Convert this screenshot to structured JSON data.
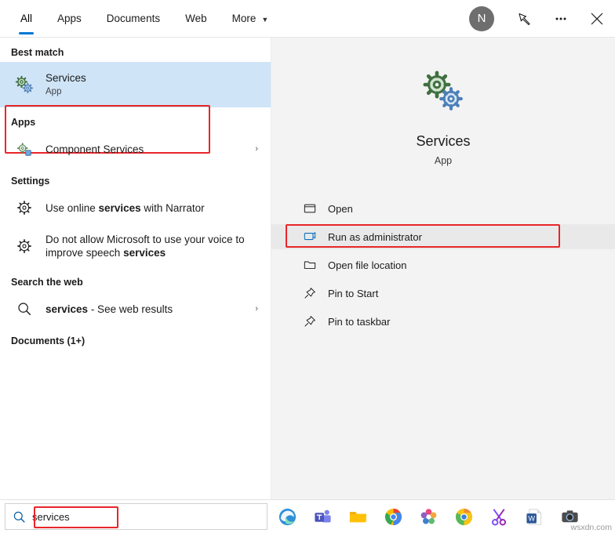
{
  "topbar": {
    "tabs": [
      {
        "label": "All",
        "active": true,
        "chevron": false,
        "name": "tab-all"
      },
      {
        "label": "Apps",
        "active": false,
        "chevron": false,
        "name": "tab-apps"
      },
      {
        "label": "Documents",
        "active": false,
        "chevron": false,
        "name": "tab-documents"
      },
      {
        "label": "Web",
        "active": false,
        "chevron": false,
        "name": "tab-web"
      },
      {
        "label": "More",
        "active": false,
        "chevron": true,
        "name": "tab-more"
      }
    ],
    "avatar_initial": "N",
    "feedback_icon": "feedback-icon",
    "more_icon": "ellipsis-icon",
    "close_icon": "close-icon",
    "close_label": "✕"
  },
  "left": {
    "best_match_header": "Best match",
    "best_match": {
      "title": "Services",
      "subtitle": "App",
      "icon": "services-gears-icon"
    },
    "apps_header": "Apps",
    "apps": [
      {
        "title": "Component Services",
        "icon": "component-services-icon",
        "chevron": "›"
      }
    ],
    "settings_header": "Settings",
    "settings": [
      {
        "title_prefix": "Use online ",
        "title_bold": "services",
        "title_suffix": " with Narrator",
        "icon": "settings-gear-icon"
      },
      {
        "title_prefix": "Do not allow Microsoft to use your voice to improve speech ",
        "title_bold": "services",
        "title_suffix": "",
        "icon": "settings-gear-icon"
      }
    ],
    "web_header": "Search the web",
    "web": [
      {
        "title_bold": "services",
        "title_suffix": " - See web results",
        "icon": "web-search-icon",
        "chevron": "›"
      }
    ],
    "documents_header": "Documents (1+)"
  },
  "right": {
    "app_title": "Services",
    "app_subtitle": "App",
    "app_icon": "services-gears-icon",
    "actions": [
      {
        "label": "Open",
        "icon": "open-window-icon",
        "highlighted": false,
        "boxed": false
      },
      {
        "label": "Run as administrator",
        "icon": "shield-run-icon",
        "highlighted": true,
        "boxed": true
      },
      {
        "label": "Open file location",
        "icon": "folder-icon",
        "highlighted": false,
        "boxed": false
      },
      {
        "label": "Pin to Start",
        "icon": "pin-icon",
        "highlighted": false,
        "boxed": false
      },
      {
        "label": "Pin to taskbar",
        "icon": "pin-icon",
        "highlighted": false,
        "boxed": false
      }
    ]
  },
  "taskbar": {
    "search_value": "services",
    "search_icon": "search-icon",
    "icons": [
      {
        "name": "edge-icon"
      },
      {
        "name": "teams-icon"
      },
      {
        "name": "file-explorer-icon"
      },
      {
        "name": "chrome-icon"
      },
      {
        "name": "flower-app-icon"
      },
      {
        "name": "chrome-canary-icon"
      },
      {
        "name": "snip-sketch-icon"
      },
      {
        "name": "word-icon"
      },
      {
        "name": "camera-icon"
      }
    ],
    "watermark": "wsxdn.com"
  },
  "colors": {
    "accent": "#0078d4",
    "selection": "#cfe4f7",
    "highlight_box": "#e8262a",
    "right_bg": "#f3f3f3"
  }
}
